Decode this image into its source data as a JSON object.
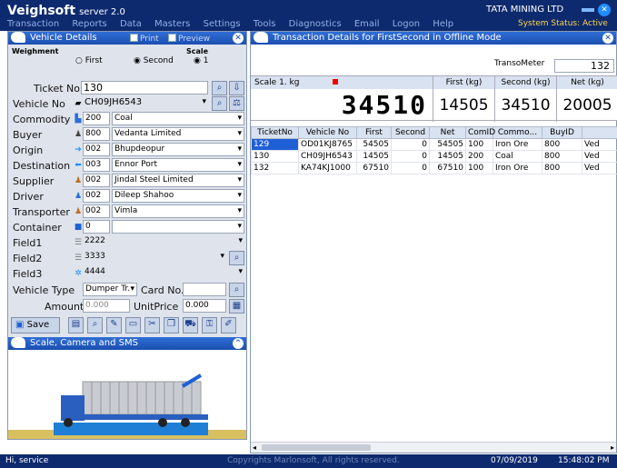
{
  "app": {
    "name": "Veighsoft",
    "version": "server 2.0",
    "company": "TATA MINING LTD",
    "system_status": "System Status: Active"
  },
  "menu": [
    "Transaction",
    "Reports",
    "Data",
    "Masters",
    "Settings",
    "Tools",
    "Diagnostics",
    "Email",
    "Logon",
    "Help"
  ],
  "vehicle_details": {
    "title": "Vehicle Details",
    "print_label": "Print",
    "preview_label": "Preview",
    "weighment_label": "Weighment",
    "first_label": "First",
    "second_label": "Second",
    "scale_label": "Scale",
    "scale_value": "1",
    "ticket_label": "Ticket No.",
    "ticket_value": "130",
    "vehicle_label": "Vehicle No",
    "vehicle_value": "CH09JH6543",
    "commodity_label": "Commodity",
    "commodity_code": "200",
    "commodity_name": "Coal",
    "buyer_label": "Buyer",
    "buyer_code": "800",
    "buyer_name": "Vedanta Limited",
    "origin_label": "Origin",
    "origin_code": "002",
    "origin_name": "Bhupdeopur",
    "destination_label": "Destination",
    "destination_code": "003",
    "destination_name": "Ennor Port",
    "supplier_label": "Supplier",
    "supplier_code": "002",
    "supplier_name": "Jindal Steel Limited",
    "driver_label": "Driver",
    "driver_code": "002",
    "driver_name": "Dileep Shahoo",
    "transporter_label": "Transporter",
    "transporter_code": "002",
    "transporter_name": "Vimla",
    "container_label": "Container",
    "container_value": "0",
    "field1_label": "Field1",
    "field1_value": "2222",
    "field2_label": "Field2",
    "field2_value": "3333",
    "field3_label": "Field3",
    "field3_value": "4444",
    "vehicle_type_label": "Vehicle Type",
    "vehicle_type_value": "Dumper Tr.",
    "card_label": "Card No.",
    "amount_label": "Amount",
    "amount_value": "0.000",
    "unitprice_label": "UnitPrice",
    "unitprice_value": "0.000",
    "save_label": "Save"
  },
  "scale_camera": {
    "title": "Scale, Camera and SMS"
  },
  "transaction": {
    "title": "Transaction Details for FirstSecond in Offline Mode",
    "transometer_label": "TransoMeter",
    "transometer_value": "132",
    "scale_label": "Scale 1. kg",
    "reading": "34510",
    "first_header": "First (kg)",
    "first_value": "14505",
    "second_header": "Second (kg)",
    "second_value": "34510",
    "net_header": "Net (kg)",
    "net_value": "20005",
    "columns": [
      "TicketNo",
      "Vehicle No",
      "First",
      "Second",
      "Net",
      "ComID",
      "Commo...",
      "BuyID",
      ""
    ],
    "rows": [
      [
        "129",
        "OD01KJ8765",
        "54505",
        "0",
        "54505",
        "100",
        "Iron Ore",
        "800",
        "Ved"
      ],
      [
        "130",
        "CH09JH6543",
        "14505",
        "0",
        "14505",
        "200",
        "Coal",
        "800",
        "Ved"
      ],
      [
        "132",
        "KA74KJ1000",
        "67510",
        "0",
        "67510",
        "100",
        "Iron Ore",
        "800",
        "Ved"
      ]
    ]
  },
  "statusbar": {
    "user": "Hi, service",
    "copyright": "Copyrights Marlonsoft, All rights reserved.",
    "date": "07/09/2019",
    "time": "15:48:02 PM"
  },
  "colors": {
    "title": "#0e2a6e",
    "panel_header": "#1c4fb0",
    "selected_row": "#1f5fd6",
    "status": "#ffd54a"
  }
}
